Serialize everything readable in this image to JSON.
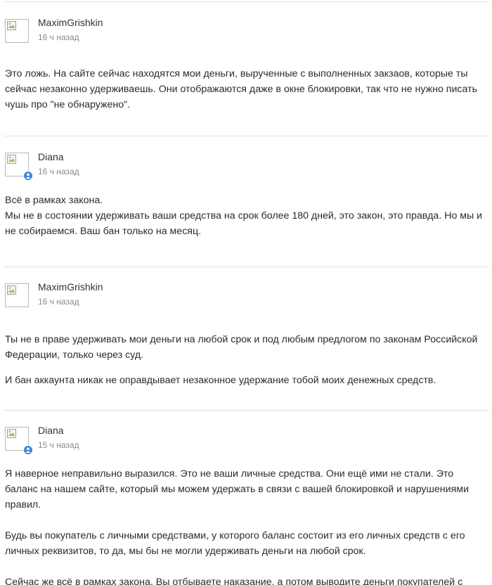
{
  "comments": [
    {
      "author": "MaximGrishkin",
      "time": "16 ч назад",
      "is_staff": false,
      "paragraphs": [
        "Это ложь. На сайте сейчас находятся мои деньги,  вырученные с  выполненных закзаов, которые ты сейчас незаконно удерживаешь. Они отображаются даже в окне блокировки, так что не нужно писать чушь про \"не обнаружено\"."
      ]
    },
    {
      "author": "Diana",
      "time": "16 ч назад",
      "is_staff": true,
      "paragraphs": [
        "Всё в рамках закона.",
        "Мы не в состоянии удерживать ваши средства на срок более 180 дней, это закон, это правда. Но мы и не собираемся. Ваш бан только на месяц."
      ]
    },
    {
      "author": "MaximGrishkin",
      "time": "16 ч назад",
      "is_staff": false,
      "paragraphs": [
        "Ты не в праве удерживать мои деньги на любой срок и под любым предлогом по законам Российской Федерации, только через суд.",
        "И бан аккаунта никак не оправдывает незаконное удержание тобой моих денежных средств."
      ]
    },
    {
      "author": "Diana",
      "time": "15 ч назад",
      "is_staff": true,
      "paragraphs": [
        "Я наверное неправильно выразился. Это не ваши личные средства. Они ещё ими не стали. Это баланс на нашем сайте, который мы можем удержать в связи с вашей блокировкой и нарушениями правил.",
        "Будь вы покупатель с личными средствами, у которого баланс состоит из его личных средств с его личных реквизитов, то да, мы бы не могли удерживать деньги на любой срок.",
        "Сейчас же всё в рамках закона. Вы отбываете наказание, а потом выводите деньги покупателей с нашего"
      ]
    }
  ],
  "colors": {
    "divider": "#e1e1e1",
    "text": "#2b2b2b",
    "muted": "#8a8a8a",
    "staff_badge": "#3f86d9"
  },
  "icons": {
    "avatar_placeholder": "broken-image-icon",
    "staff_badge": "user-icon"
  }
}
